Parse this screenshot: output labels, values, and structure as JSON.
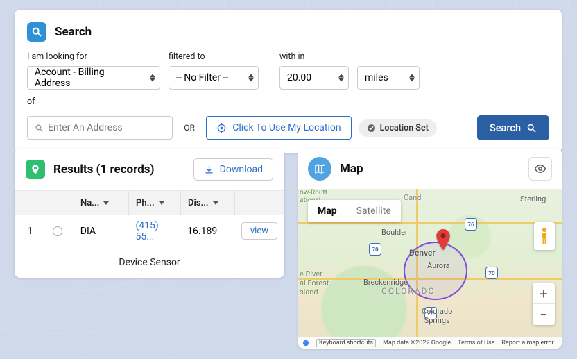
{
  "search": {
    "title": "Search",
    "looking_for_label": "I am looking for",
    "looking_for_value": "Account - Billing Address",
    "filtered_label": "filtered to",
    "filtered_value": "-- No Filter --",
    "within_label": "with in",
    "within_value": "20.00",
    "within_unit": "miles",
    "of_label": "of",
    "address_placeholder": "Enter An Address",
    "or_label": "- OR -",
    "use_location_label": "Click To Use My Location",
    "location_set_label": "Location Set",
    "search_button": "Search"
  },
  "results": {
    "title": "Results (1 records)",
    "download_label": "Download",
    "columns": {
      "name": "Na...",
      "phone": "Ph...",
      "distance": "Dis..."
    },
    "rows": [
      {
        "idx": "1",
        "name": "DIA",
        "phone": "(415) 55...",
        "distance": "16.189",
        "action": "view"
      }
    ],
    "footer_label": "Device Sensor"
  },
  "map": {
    "title": "Map",
    "type_map": "Map",
    "type_sat": "Satellite",
    "labels": {
      "colorado": "COLORADO",
      "denver": "Denver",
      "aurora": "Aurora",
      "boulder": "Boulder",
      "sterling": "Sterling",
      "breckenridge": "Breckenridge",
      "csprings": "Colorado\nSprings",
      "river_forest": "e River\nal Forest\nsland"
    },
    "shields": {
      "i70a": "70",
      "i70b": "70",
      "i76": "76",
      "i25": "25"
    },
    "footer": {
      "kbd": "Keyboard shortcuts",
      "data": "Map data ©2022 Google",
      "terms": "Terms of Use",
      "error": "Report a map error"
    }
  }
}
